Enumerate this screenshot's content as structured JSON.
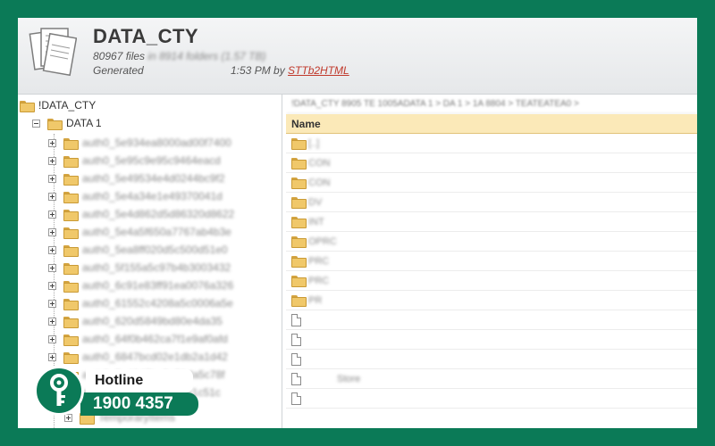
{
  "header": {
    "title": "DATA_CTY",
    "files_count": "80967 files",
    "folders_info": "in 8914 folders (1.57 TB)",
    "generated_label": "Generated",
    "time_text": "1:53 PM by",
    "generator_link": "STTb2HTML"
  },
  "tree": {
    "root": "!DATA_CTY",
    "child": "DATA 1",
    "items": [
      "auth0_5e934ea8000ad00f7400",
      "auth0_5e95c9e95c9464eacd",
      "auth0_5e49534e4d0244bc9f2",
      "auth0_5e4a34e1e49370041d",
      "auth0_5e4d862d5d86320d8622",
      "auth0_5e4a5f650a7767ab4b3e",
      "auth0_5ea8ff020d5c500d51e0",
      "auth0_5f155a5c97b4b3003432",
      "auth0_6c91e83ff91ea0076a326",
      "auth0_61552c4208a5c0006a5e",
      "auth0_620d5849bd80e4da35",
      "auth0_64f0b462ca7f1e9af0afd",
      "auth0_6847bcd02e1db2a1d42",
      "auth0_5e4847be2a51da5c78f",
      "auth0_5ed81d5p444c51c51c"
    ],
    "temp_folder": "TemporaryItems"
  },
  "listing": {
    "breadcrumb": "!DATA_CTY 8905 TE 1005ADATA 1 > DA 1 > 1A 8804 > TEATEATEA0 >",
    "column_name": "Name",
    "folders": [
      "[..]",
      "CON",
      "CON",
      "DV",
      "INT",
      "OPRC",
      "PRC",
      "PRC",
      "PR"
    ],
    "file_label": "Store"
  },
  "hotline": {
    "label": "Hotline",
    "number": "1900 4357"
  },
  "colors": {
    "brand_green": "#0b7a57",
    "column_header_bg": "#fbe9b8",
    "link_red": "#c0392b"
  }
}
